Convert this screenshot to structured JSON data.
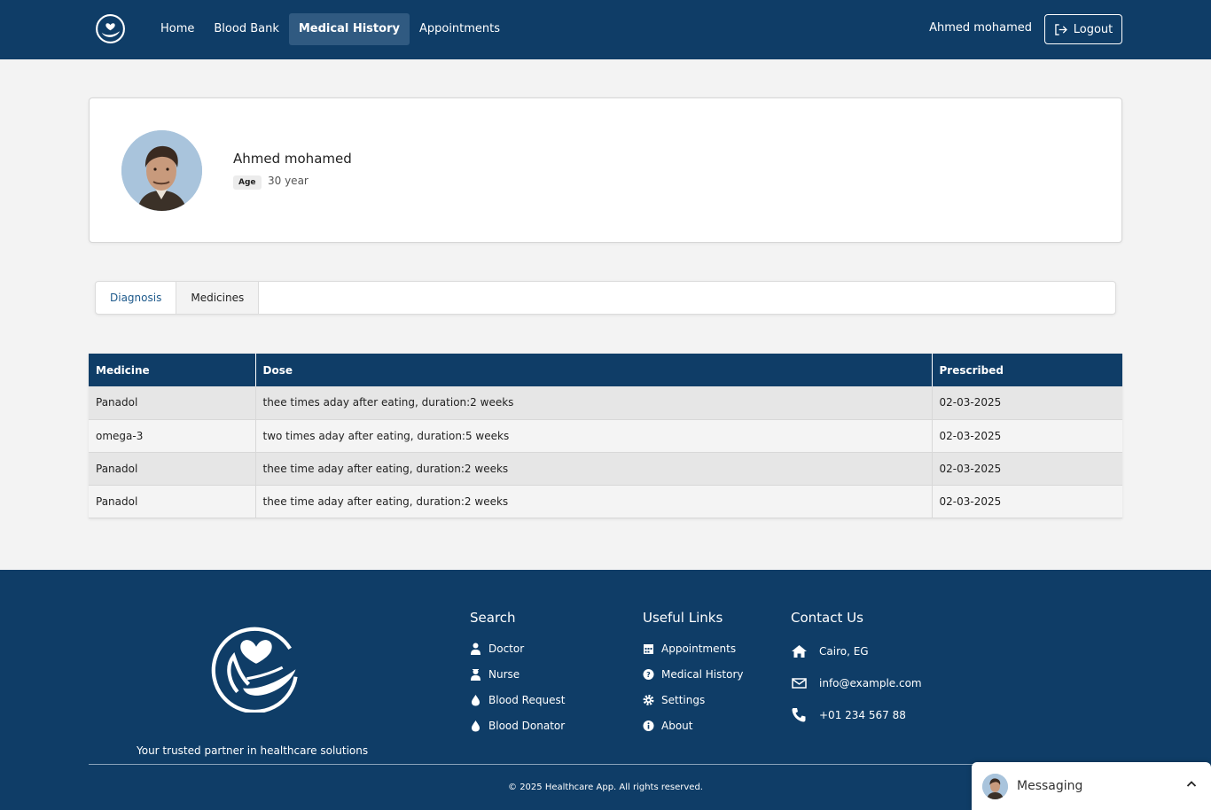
{
  "nav": {
    "links": [
      "Home",
      "Blood Bank",
      "Medical History",
      "Appointments"
    ],
    "active": "Medical History",
    "user_name": "Ahmed mohamed",
    "logout_label": "Logout"
  },
  "profile": {
    "name": "Ahmed mohamed",
    "age_label": "Age",
    "age_value": "30 year"
  },
  "tabs": [
    "Diagnosis",
    "Medicines"
  ],
  "active_tab": "Medicines",
  "medicines": {
    "headers": [
      "Medicine",
      "Dose",
      "Prescribed"
    ],
    "rows": [
      [
        "Panadol",
        "thee times aday after eating, duration:2 weeks",
        "02-03-2025"
      ],
      [
        "omega-3",
        "two times aday after eating, duration:5 weeks",
        "02-03-2025"
      ],
      [
        "Panadol",
        "thee time aday after eating, duration:2 weeks",
        "02-03-2025"
      ],
      [
        "Panadol",
        "thee time aday after eating, duration:2 weeks",
        "02-03-2025"
      ]
    ]
  },
  "footer": {
    "tagline": "Your trusted partner in healthcare solutions",
    "search": {
      "title": "Search",
      "items": [
        {
          "label": "Doctor",
          "icon": "doctor-icon"
        },
        {
          "label": "Nurse",
          "icon": "nurse-icon"
        },
        {
          "label": "Blood Request",
          "icon": "blood-drop-icon"
        },
        {
          "label": "Blood Donator",
          "icon": "blood-drop-icon"
        }
      ]
    },
    "useful_links": {
      "title": "Useful Links",
      "items": [
        {
          "label": "Appointments",
          "icon": "calendar-icon"
        },
        {
          "label": "Medical History",
          "icon": "question-circle-icon"
        },
        {
          "label": "Settings",
          "icon": "gear-icon"
        },
        {
          "label": "About",
          "icon": "info-circle-icon"
        }
      ]
    },
    "contact": {
      "title": "Contact Us",
      "items": [
        {
          "label": "Cairo, EG",
          "icon": "home-icon"
        },
        {
          "label": "info@example.com",
          "icon": "envelope-icon"
        },
        {
          "label": "+01 234 567 88",
          "icon": "phone-icon"
        }
      ]
    },
    "copyright": "© 2025 Healthcare App. All rights reserved."
  },
  "messaging": {
    "label": "Messaging"
  },
  "colors": {
    "primary": "#0f3d67",
    "active_nav": "#305a81",
    "page_bg": "#f3f3f3"
  }
}
